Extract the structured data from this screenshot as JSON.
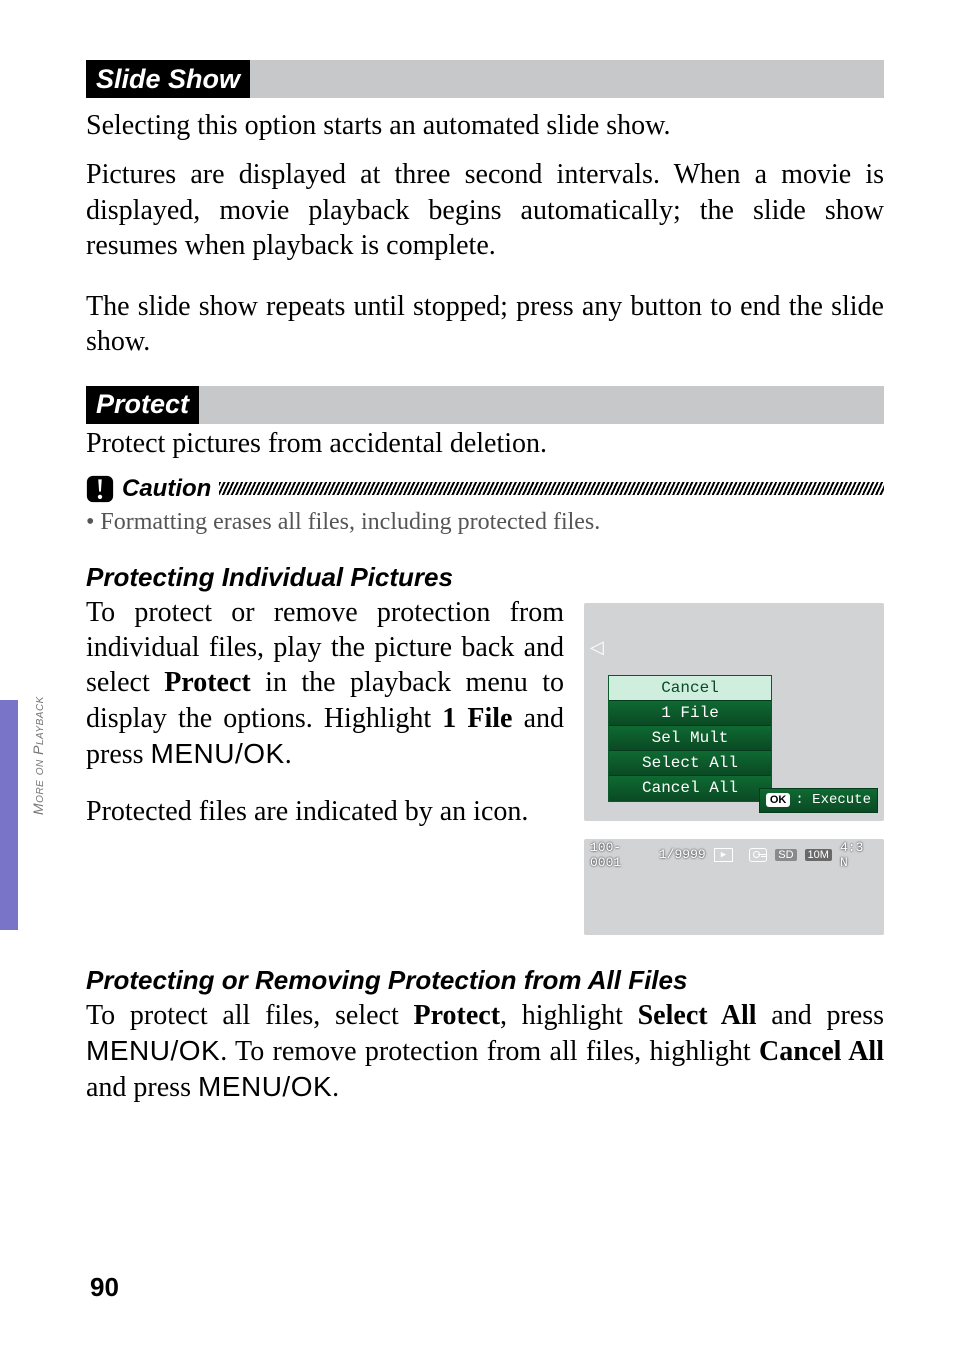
{
  "side_tab": "More on Playback",
  "page_number": "90",
  "sec1": {
    "title": "Slide Show",
    "p1": "Selecting this option starts an automated slide show.",
    "p2": "Pictures are displayed at three second intervals. When a movie is displayed, movie playback begins automatically; the slide show resumes when playback is complete.",
    "p3": "The slide show repeats until stopped; press any button to end the slide show."
  },
  "sec2": {
    "title": "Protect",
    "p1": "Protect pictures from accidental deletion.",
    "caution_label": "Caution",
    "caution_item": "Formatting erases all files, including protected files.",
    "sub1_title": "Protecting Individual Pictures",
    "sub1_p_pre": "To protect or remove protection from individual files, play the picture back and select ",
    "sub1_p_protect": "Protect",
    "sub1_p_mid": " in the playback menu to display the options. Highlight ",
    "sub1_p_file": "1 File",
    "sub1_p_post1": " and press ",
    "sub1_p_menuok": "MENU/OK",
    "sub1_p_end": ".",
    "sub1_p2": "Protected files are indicated by an icon.",
    "sub2_title": "Protecting or Removing Protection from All Files",
    "sub2_p_pre": "To protect all files, select ",
    "sub2_p_protect": "Protect",
    "sub2_p_mid1": ", highlight ",
    "sub2_p_selectall": "Select All",
    "sub2_p_mid2": " and press ",
    "sub2_p_menuok": "MENU/OK",
    "sub2_p_mid3": ". To remove protection from all files, highlight ",
    "sub2_p_cancelall": "Cancel All",
    "sub2_p_mid4": " and press ",
    "sub2_p_end": "."
  },
  "screen1": {
    "menu": {
      "items": [
        "Cancel",
        "1 File",
        "Sel Mult",
        "Select All",
        "Cancel All"
      ],
      "selected_index": 0
    },
    "ok_label": "OK",
    "execute_label": ": Execute",
    "left_arrow": "◁"
  },
  "screen2": {
    "folder_file": "100-0001",
    "counter": "1/9999",
    "sd_label": "SD",
    "size_label": "10M",
    "ratio_label": "4:3 N"
  }
}
